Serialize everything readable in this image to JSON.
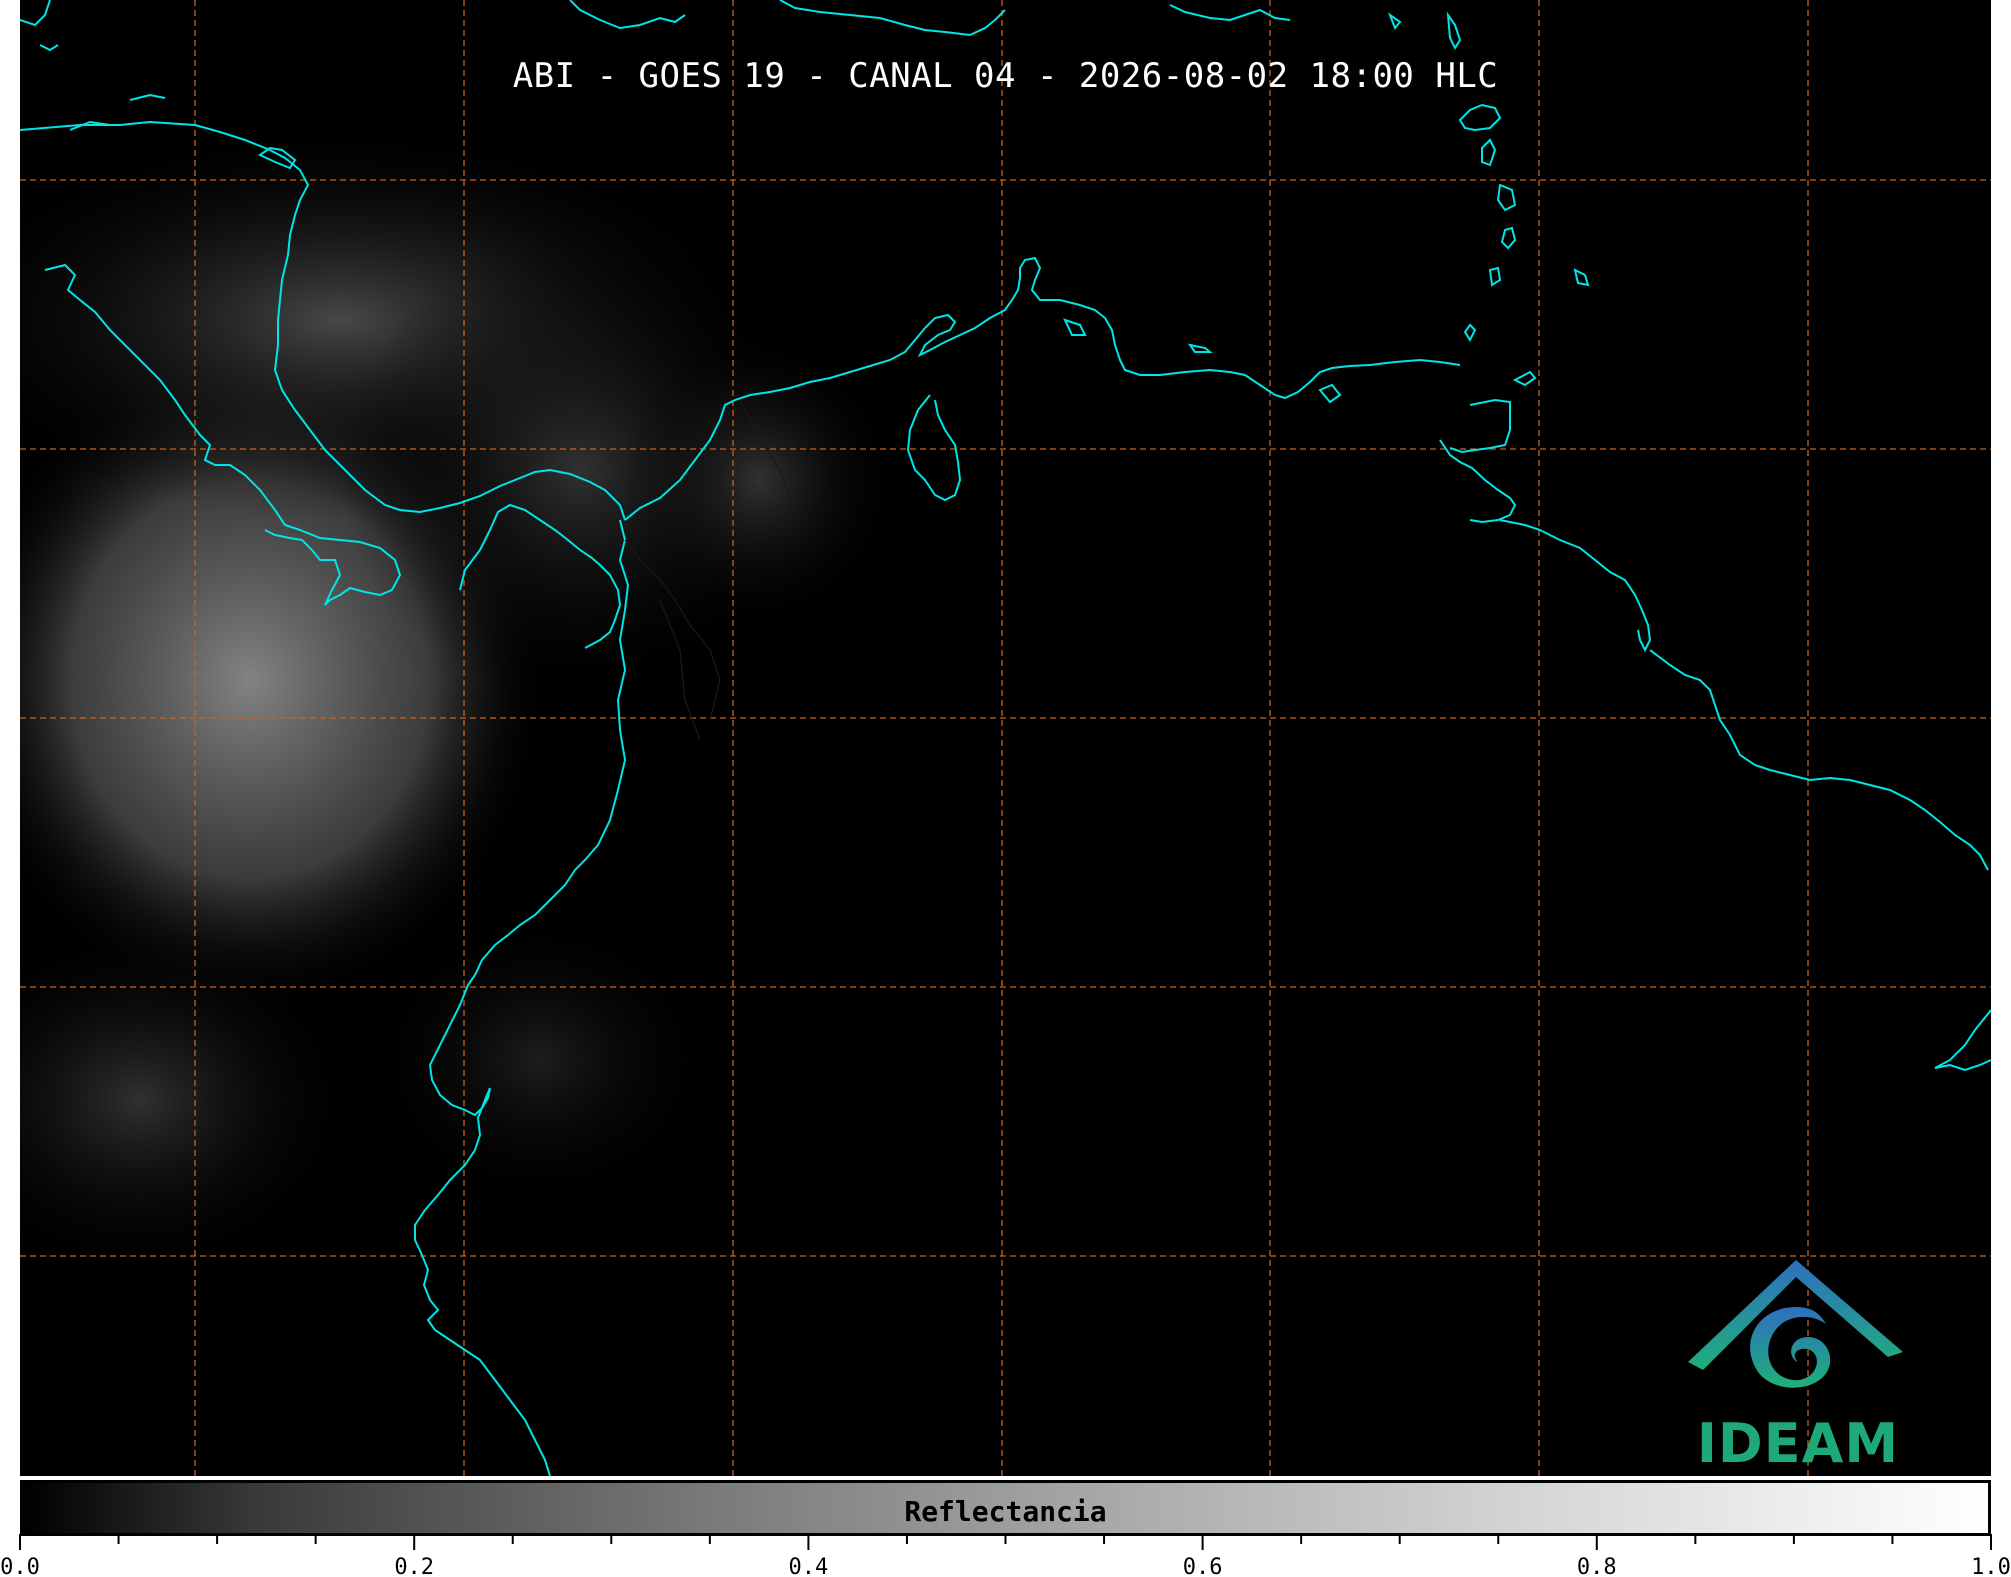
{
  "map": {
    "title": "ABI - GOES 19 - CANAL 04 - 2026-08-02 18:00 HLC",
    "coastline_color": "#00e5e5",
    "gridline_color": "#c8641e",
    "background_color": "#000000"
  },
  "colorbar": {
    "label": "Reflectancia",
    "tick_labels": [
      "0.0",
      "0.2",
      "0.4",
      "0.6",
      "0.8",
      "1.0"
    ],
    "range": [
      0.0,
      1.0
    ]
  },
  "logo": {
    "text": "IDEAM",
    "color": "#1fa97a"
  }
}
